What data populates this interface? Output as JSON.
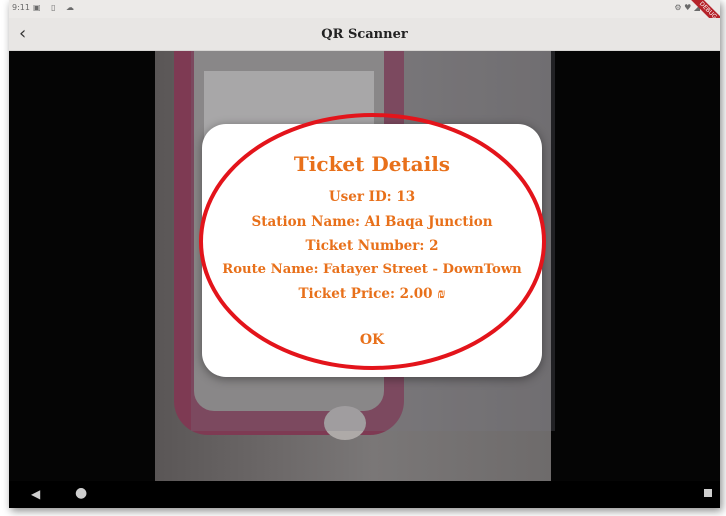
{
  "status_bar": {
    "time": "9:11",
    "left_icons": "▣ ▯ ☁",
    "right_icons": "⚙ ♥ ◢"
  },
  "debug_banner": "DEBUG",
  "app_bar": {
    "back_icon": "‹",
    "title": "QR Scanner"
  },
  "dialog": {
    "title": "Ticket Details",
    "user_id": "User ID: 13",
    "station_name": "Station Name: Al Baqa Junction",
    "ticket_number": "Ticket Number: 2",
    "route_name": "Route Name: Fatayer Street - DownTown",
    "ticket_price": "Ticket Price: 2.00 ₪",
    "ok_label": "OK"
  },
  "nav_bar": {
    "back": "◀",
    "home": "●"
  },
  "colors": {
    "accent": "#e8701a",
    "annotation": "#e3141b",
    "app_bar": "#e8e6e4"
  }
}
